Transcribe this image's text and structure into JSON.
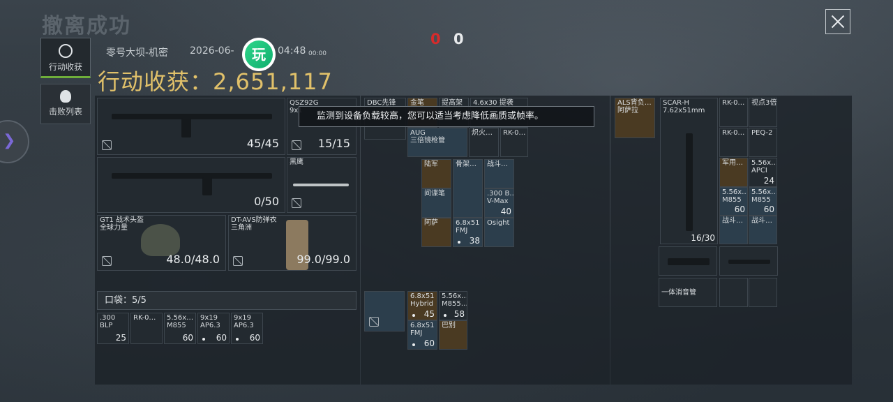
{
  "header": {
    "title": "撤离成功",
    "score_red": "0",
    "score_white": "0",
    "close_label": "×"
  },
  "tabs": [
    {
      "label": "行动收获"
    },
    {
      "label": "击败列表"
    }
  ],
  "meta": {
    "map": "零号大坝-机密",
    "date": "2026-06-",
    "time": "04:48",
    "duration": "00:00",
    "watermark": "玩"
  },
  "earnings": "行动收获：2,651,117",
  "notice": "监测到设备负载较高，您可以适当考虑降低画质或帧率。",
  "loadout": {
    "primary": {
      "count": "45/45"
    },
    "sidearm": {
      "name": "QSZ92G",
      "sub": "9x1",
      "count": "15/15"
    },
    "secondary": {
      "count": "0/50"
    },
    "melee": {
      "name": "黑鹰"
    },
    "helmet": {
      "name": "GT1 战术头盔",
      "sub": "全球力量",
      "count": "48.0/48.0"
    },
    "armor": {
      "name": "DT-AVS防弹衣",
      "sub": "三角洲",
      "count": "99.0/99.0"
    },
    "pocket_label": "口袋：5/5"
  },
  "pocket_items": [
    {
      "name": ".300\nBLP",
      "count": "25"
    },
    {
      "name": "RK-0…",
      "count": ""
    },
    {
      "name": "5.56x…\nM855",
      "count": "60"
    },
    {
      "name": "9x19\nAP6.3",
      "count": "60"
    },
    {
      "name": "9x19\nAP6.3",
      "count": "60"
    }
  ],
  "chest_items": [
    {
      "name": "DBC先锋"
    },
    {
      "name": "金笔"
    },
    {
      "name": "提高架"
    },
    {
      "name": "4.6x30 提袭"
    },
    {
      "name": "AUG\n三倍镜枪管"
    },
    {
      "name": "炽火…"
    },
    {
      "name": "RK-0…"
    },
    {
      "name": "陆军"
    },
    {
      "name": "骨架…"
    },
    {
      "name": "战斗…"
    },
    {
      "name": "间谍笔"
    },
    {
      "name": ".300 B…\nV-Max",
      "count": "40"
    },
    {
      "name": "阿萨"
    },
    {
      "name": "6.8x51\nFMJ",
      "count": "38"
    },
    {
      "name": "Osight"
    }
  ],
  "bag_items": [
    {
      "name": "6.8x51\nHybrid",
      "count": "45"
    },
    {
      "name": "5.56x…\nM855…",
      "count": "58"
    },
    {
      "name": "6.8x51\nFMJ",
      "count": "60"
    },
    {
      "name": "巴别"
    }
  ],
  "right": {
    "backpack": {
      "name": "ALS背负…\n阿萨拉"
    },
    "rifle": {
      "name": "SCAR-H\n7.62x51mm",
      "count": "16/30"
    },
    "attachments": [
      {
        "name": "RK-0…"
      },
      {
        "name": "视点3倍"
      },
      {
        "name": "RK-0…"
      },
      {
        "name": "PEQ-2"
      },
      {
        "name": "军用…"
      },
      {
        "name": "5.56x…\nAPCI",
        "count": "24"
      },
      {
        "name": "5.56x…\nM855",
        "count": "60"
      },
      {
        "name": "5.56x…\nM855",
        "count": "60"
      },
      {
        "name": "战斗…"
      },
      {
        "name": "战斗…"
      }
    ],
    "suppressor": {
      "name": "一体消音管"
    }
  }
}
